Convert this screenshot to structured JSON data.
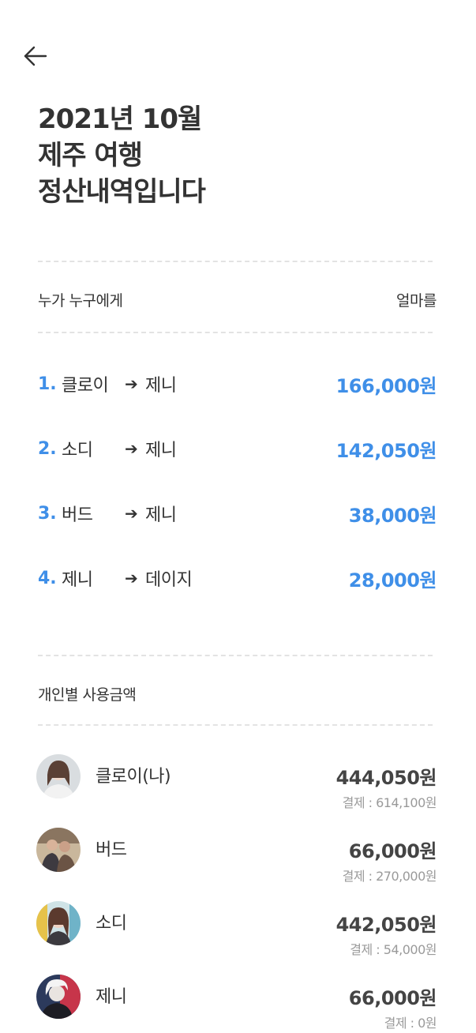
{
  "header": {
    "back_icon": "arrow-left-icon",
    "title_lines": [
      "2021년 10월",
      "제주 여행",
      "정산내역입니다"
    ]
  },
  "settlement_section": {
    "left_label": "누가 누구에게",
    "right_label": "얼마를",
    "transfers": [
      {
        "index": "1.",
        "from": "클로이",
        "arrow": "➔",
        "to": "제니",
        "amount": "166,000원"
      },
      {
        "index": "2.",
        "from": "소디",
        "arrow": "➔",
        "to": "제니",
        "amount": "142,050원"
      },
      {
        "index": "3.",
        "from": "버드",
        "arrow": "➔",
        "to": "제니",
        "amount": "38,000원"
      },
      {
        "index": "4.",
        "from": "제니",
        "arrow": "➔",
        "to": "데이지",
        "amount": "28,000원"
      }
    ]
  },
  "usage_section": {
    "label": "개인별 사용금액",
    "people": [
      {
        "name": "클로이(나)",
        "amount": "444,050원",
        "paid": "결제 : 614,100원",
        "avatar": "user-avatar-icon"
      },
      {
        "name": "버드",
        "amount": "66,000원",
        "paid": "결제 : 270,000원",
        "avatar": "user-avatar-icon"
      },
      {
        "name": "소디",
        "amount": "442,050원",
        "paid": "결제 : 54,000원",
        "avatar": "user-avatar-icon"
      },
      {
        "name": "제니",
        "amount": "66,000원",
        "paid": "결제 : 0원",
        "avatar": "user-avatar-icon"
      }
    ]
  },
  "colors": {
    "accent": "#3f8fe8",
    "text": "#333333",
    "muted": "#9a9a9a",
    "divider": "#e3e3e3"
  }
}
